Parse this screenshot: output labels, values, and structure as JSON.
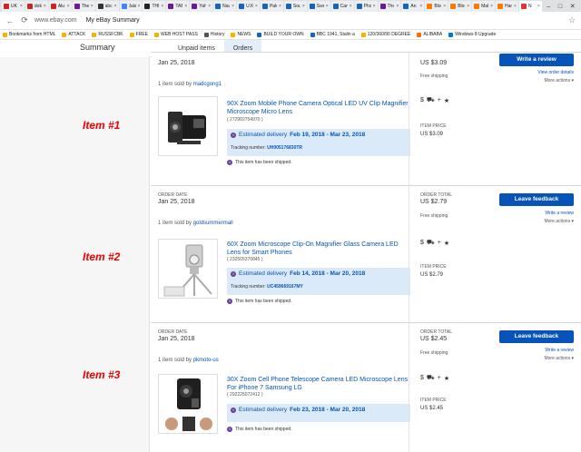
{
  "browser": {
    "tabs": [
      {
        "label": "UK",
        "color": "#c62828"
      },
      {
        "label": "dok",
        "color": "#c62828"
      },
      {
        "label": "Alu",
        "color": "#c62828"
      },
      {
        "label": "The",
        "color": "#6a1b9a"
      },
      {
        "label": "abc",
        "color": "#333333"
      },
      {
        "label": "Jala",
        "color": "#4285f4"
      },
      {
        "label": "THE",
        "color": "#222222"
      },
      {
        "label": "TAB",
        "color": "#6a1b9a"
      },
      {
        "label": "Yah",
        "color": "#6a1b9a"
      },
      {
        "label": "Nav",
        "color": "#1565c0"
      },
      {
        "label": "U.K.",
        "color": "#1565c0"
      },
      {
        "label": "Pak",
        "color": "#1565c0"
      },
      {
        "label": "Sou",
        "color": "#1565c0"
      },
      {
        "label": "Swe",
        "color": "#1565c0"
      },
      {
        "label": "Can",
        "color": "#1565c0"
      },
      {
        "label": "Pho",
        "color": "#1565c0"
      },
      {
        "label": "The",
        "color": "#6a1b9a"
      },
      {
        "label": "An",
        "color": "#1565c0"
      },
      {
        "label": "Blog",
        "color": "#f57c00"
      },
      {
        "label": "Blog",
        "color": "#f57c00"
      },
      {
        "label": "Mak",
        "color": "#f57c00"
      },
      {
        "label": "Har",
        "color": "#f57c00"
      },
      {
        "label": "N",
        "color": "#e53238"
      }
    ],
    "url": "www.ebay.com",
    "title": "My eBay Summary",
    "bookmarks": [
      "Bookmarks from HTML",
      "ATTACK",
      "RUSSFCBK",
      "FREE",
      "WEB HOST PASS",
      "History",
      "NEWS",
      "BUILD YOUR OWN",
      "BBC 1941, Stalin a",
      "120/360/90 DEGREE",
      "ALIBABA",
      "Windows 8 Upgrade"
    ]
  },
  "page": {
    "summary_title": "Summary",
    "tabs": [
      "Unpaid items",
      "Orders"
    ]
  },
  "item_labels": [
    "Item #1",
    "Item #2",
    "Item #3"
  ],
  "orders": [
    {
      "order_date_label": "",
      "order_date": "Jan 25, 2018",
      "order_total_label": "",
      "order_total": "US $3.09",
      "shipping": "Free shipping",
      "sold_by_prefix": "1 item sold by",
      "seller": "madcgong1",
      "button": "Write a review",
      "links": [
        "View order details"
      ],
      "more_actions": "More actions ▾",
      "title": "90X Zoom Mobile Phone Camera Optical LED UV Clip Magnifier Microscope Micro Lens",
      "product_id": "( 272902754970 )",
      "delivery_label": "Estimated delivery",
      "delivery_dates": "Feb 19, 2018 - Mar 23, 2018",
      "tracking_label": "Tracking number:",
      "tracking": "UH005176830TR",
      "shipped": "This item has been shipped.",
      "item_price_label": "ITEM PRICE",
      "item_price": "US $3.09"
    },
    {
      "order_date_label": "ORDER DATE",
      "order_date": "Jan 25, 2018",
      "order_total_label": "ORDER TOTAL",
      "order_total": "US $2.79",
      "shipping": "Free shipping",
      "sold_by_prefix": "1 item sold by",
      "seller": "goldsummermall",
      "button": "Leave feedback",
      "links": [
        "Write a review"
      ],
      "more_actions": "More actions ▾",
      "title": "60X Zoom Microscope Clip-On Magnifier Glass Camera LED Lens for Smart Phones",
      "product_id": "( 232505370845 )",
      "delivery_label": "Estimated delivery",
      "delivery_dates": "Feb 14, 2018 - Mar 20, 2018",
      "tracking_label": "Tracking number:",
      "tracking": "UC459669167MY",
      "shipped": "This item has been shipped.",
      "item_price_label": "ITEM PRICE",
      "item_price": "US $2.79"
    },
    {
      "order_date_label": "ORDER DATE",
      "order_date": "Jan 25, 2018",
      "order_total_label": "ORDER TOTAL",
      "order_total": "US $2.45",
      "shipping": "Free shipping",
      "sold_by_prefix": "1 item sold by",
      "seller": "pkmoto-us",
      "button": "Leave feedback",
      "links": [
        "Write a review"
      ],
      "more_actions": "More actions ▾",
      "title": "30X Zoom Cell Phone Telescope Camera LED Microscope Lens For iPhone 7 Samsung LG",
      "product_id": "( 292225072412 )",
      "delivery_label": "Estimated delivery",
      "delivery_dates": "Feb 23, 2018 - Mar 20, 2018",
      "tracking_label": "",
      "tracking": "",
      "shipped": "This item has been shipped.",
      "item_price_label": "ITEM PRICE",
      "item_price": "US $2.45"
    }
  ]
}
